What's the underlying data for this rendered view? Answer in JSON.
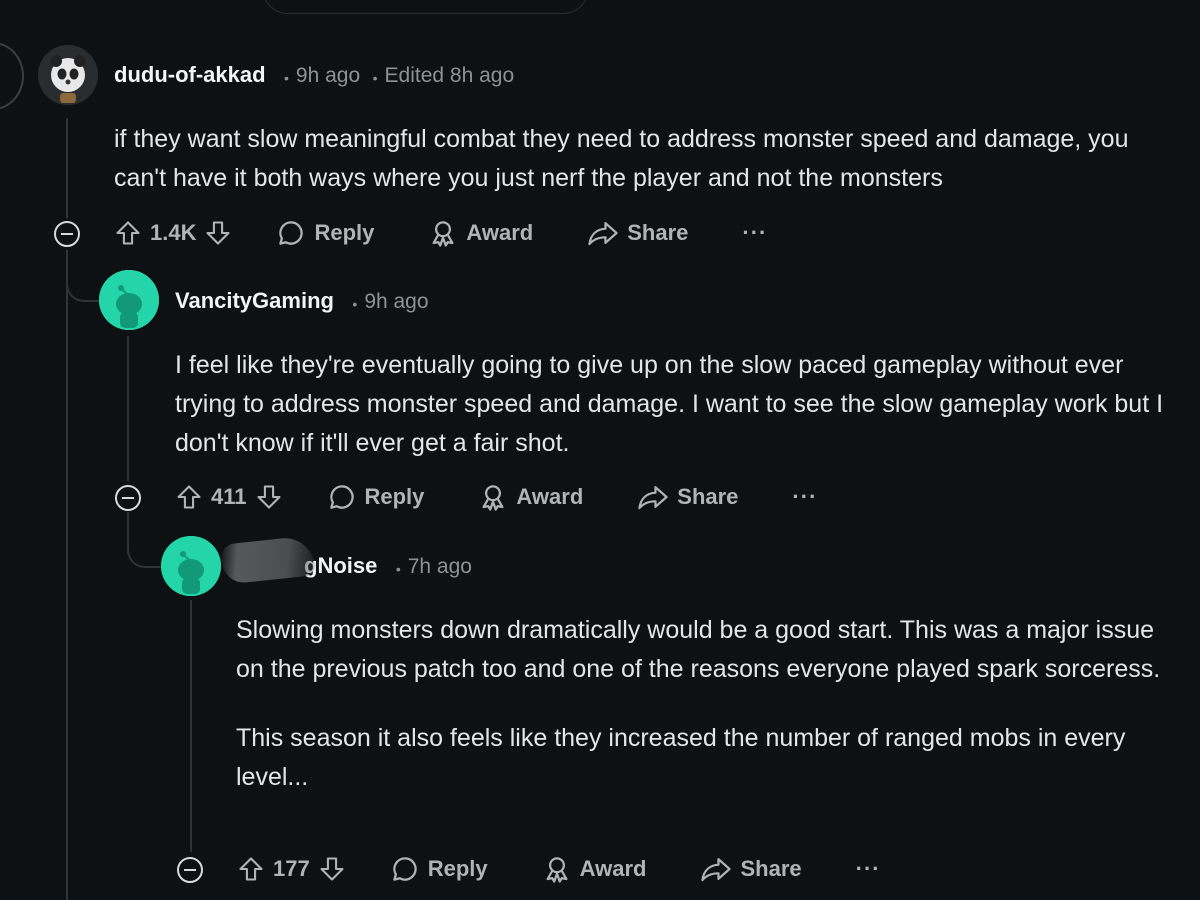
{
  "comments": [
    {
      "username": "dudu-of-akkad",
      "time": "9h ago",
      "edited": "Edited 8h ago",
      "body": [
        "if they want slow meaningful combat they need to address monster speed and damage, you can't have it both ways where you just nerf the player and not the monsters"
      ],
      "votes": "1.4K",
      "avatar": "panda-avatar"
    },
    {
      "username": "VancityGaming",
      "time": "9h ago",
      "body": [
        "I feel like they're eventually going to give up on the slow paced gameplay without ever trying to address monster speed and damage. I want to see the slow gameplay work but I don't know if it'll ever get a fair shot."
      ],
      "votes": "411",
      "avatar": "snoo-avatar"
    },
    {
      "username": "gNoise",
      "time": "7h ago",
      "body": [
        "Slowing monsters down dramatically would be a good start. This was a major issue on the previous patch too and one of the reasons everyone played spark sorceress.",
        "This season it also feels like they increased the number of ranged mobs in every level..."
      ],
      "votes": "177",
      "avatar": "snoo-avatar"
    }
  ],
  "actions": {
    "reply": "Reply",
    "award": "Award",
    "share": "Share",
    "more": "···"
  },
  "separator": "•",
  "colors": {
    "background": "#0e1113",
    "avatar_teal": "#23d5a8",
    "text": "#e3e6e8",
    "muted": "#8b9396"
  }
}
